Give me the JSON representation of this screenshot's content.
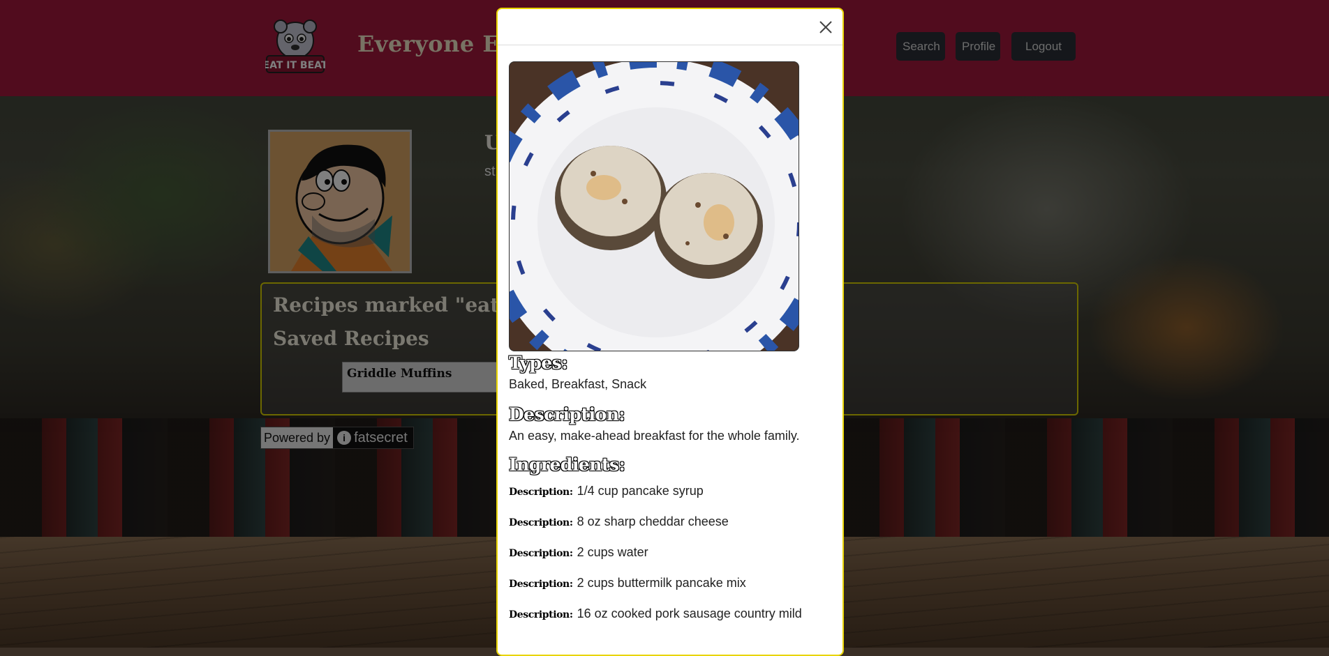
{
  "header": {
    "logo_text": "EAT IT BEAT",
    "brand": "Everyone Eats",
    "nav": {
      "search": "Search",
      "profile": "Profile",
      "logout": "Logout"
    }
  },
  "profile": {
    "heading_partial": "U",
    "sub_partial": "st"
  },
  "recipes_panel": {
    "eat_it_title": "Recipes marked \"eat it\"",
    "saved_title": "Saved Recipes",
    "saved_items": [
      "Griddle Muffins"
    ]
  },
  "powered_by": {
    "label": "Powered by",
    "brand": "fatsecret"
  },
  "modal": {
    "types_title": "Types:",
    "types": "Baked, Breakfast, Snack",
    "description_title": "Description:",
    "description": "An easy, make-ahead breakfast for the whole family.",
    "ingredients_title": "Ingredients:",
    "ingredient_label": "Description:",
    "ingredients": [
      "1/4 cup pancake syrup",
      "8 oz sharp cheddar cheese",
      "2 cups water",
      "2 cups buttermilk pancake mix",
      "16 oz cooked pork sausage country mild"
    ]
  },
  "colors": {
    "navbar": "#a3193d",
    "modal_border": "#e8d400",
    "panel_border": "#d8d000",
    "nav_button": "#2a2f36"
  }
}
